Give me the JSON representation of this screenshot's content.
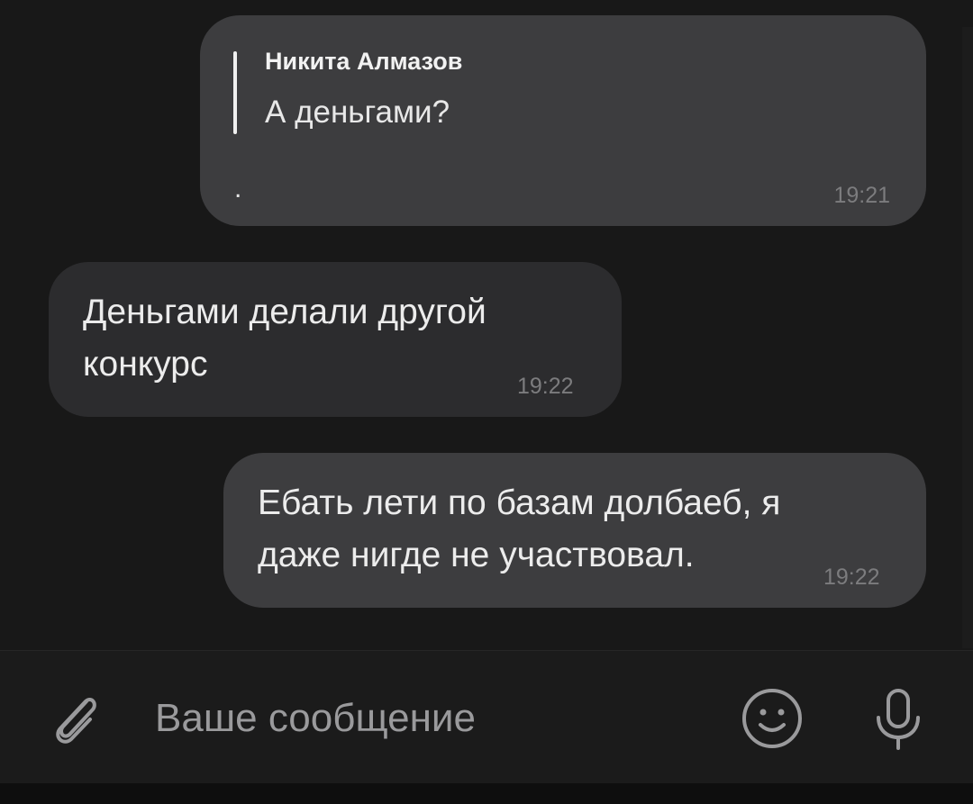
{
  "chat": {
    "messages": [
      {
        "direction": "outgoing",
        "reply": {
          "author": "Никита Алмазов",
          "text": "А деньгами?"
        },
        "text": ".",
        "time": "19:21"
      },
      {
        "direction": "incoming",
        "lines": [
          "Деньгами делали другой",
          "конкурс"
        ],
        "time": "19:22"
      },
      {
        "direction": "outgoing",
        "lines": [
          "Ебать лети по базам долбаеб, я",
          "даже нигде не участвовал."
        ],
        "time": "19:22"
      }
    ]
  },
  "composer": {
    "placeholder": "Ваше сообщение",
    "attach_icon": "paperclip-icon",
    "emoji_icon": "emoji-icon",
    "mic_icon": "microphone-icon"
  },
  "colors": {
    "background": "#181818",
    "outgoing_bubble": "#3d3d3f",
    "incoming_bubble": "#2c2c2e",
    "time_text": "#7c7c7e",
    "icon": "#9a9a9c"
  }
}
